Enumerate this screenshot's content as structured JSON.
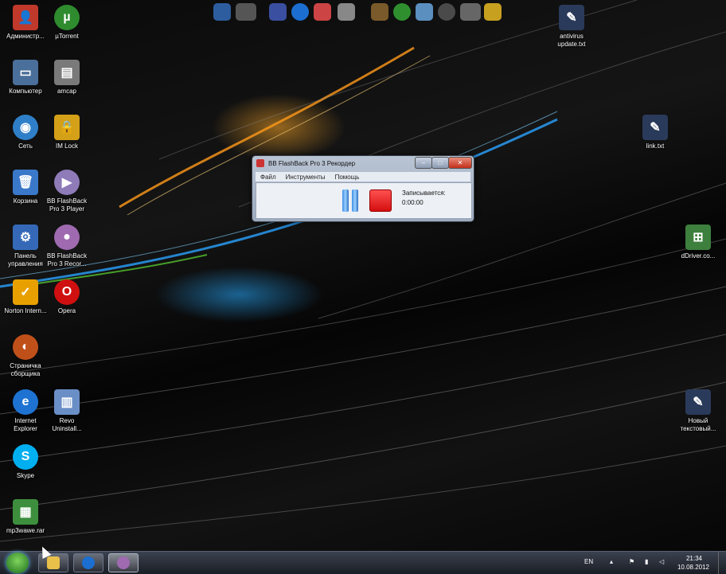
{
  "desktop_icons": [
    {
      "label": "Администр...",
      "icon": "user-icon",
      "color": "#c0392b"
    },
    {
      "label": "µTorrent",
      "icon": "utorrent-icon",
      "color": "#2e8b2e"
    },
    {
      "label": "Компьютер",
      "icon": "computer-icon",
      "color": "#4a6f9a"
    },
    {
      "label": "amcap",
      "icon": "amcap-icon",
      "color": "#7a7a7a"
    },
    {
      "label": "Сеть",
      "icon": "network-icon",
      "color": "#2f7fc8"
    },
    {
      "label": "IM Lock",
      "icon": "lock-icon",
      "color": "#d4a017"
    },
    {
      "label": "Корзина",
      "icon": "recycle-bin-icon",
      "color": "#3a78c9"
    },
    {
      "label": "BB FlashBack Pro 3 Player",
      "icon": "flashback-player-icon",
      "color": "#8e7bb8"
    },
    {
      "label": "Панель управления",
      "icon": "control-panel-icon",
      "color": "#3569b8"
    },
    {
      "label": "BB FlashBack Pro 3 Recor...",
      "icon": "flashback-recorder-icon",
      "color": "#9f6ab0"
    },
    {
      "label": "Norton Intern...",
      "icon": "norton-icon",
      "color": "#e8a000"
    },
    {
      "label": "Opera",
      "icon": "opera-icon",
      "color": "#d01010"
    },
    {
      "label": "Страничка сборщика",
      "icon": "browser-page-icon",
      "color": "#c0501a"
    },
    {
      "label": "Internet Explorer",
      "icon": "internet-explorer-icon",
      "color": "#1e73d2"
    },
    {
      "label": "Revo Uninstall...",
      "icon": "revo-uninstaller-icon",
      "color": "#6a8fc7"
    },
    {
      "label": "Skype",
      "icon": "skype-icon",
      "color": "#00aff0"
    },
    {
      "label": "mp3wawe.rar",
      "icon": "rar-archive-icon",
      "color": "#3d8f3d"
    },
    {
      "label": "antivirus update.txt",
      "icon": "text-file-icon",
      "color": "#2a3a5a"
    },
    {
      "label": "link.txt",
      "icon": "text-file-icon",
      "color": "#2a3a5a"
    },
    {
      "label": "dDriver.co...",
      "icon": "windows-file-icon",
      "color": "#3d7f3d"
    },
    {
      "label": "Новый текстовый...",
      "icon": "text-file-icon",
      "color": "#2a3a5a"
    }
  ],
  "quick_icons": [
    {
      "icon": "app-icon-1",
      "color": "#2d5d9f"
    },
    {
      "icon": "app-icon-2",
      "color": "#555555"
    },
    {
      "icon": "gamepad-icon",
      "color": "#3a4fa0"
    },
    {
      "icon": "media-player-icon",
      "color": "#1c6fd0"
    },
    {
      "icon": "paint-icon",
      "color": "#c44"
    },
    {
      "icon": "calculator-icon",
      "color": "#888888"
    },
    {
      "icon": "app-icon-3",
      "color": "#7a5a2a"
    },
    {
      "icon": "app-icon-4",
      "color": "#2f8f2f"
    },
    {
      "icon": "app-icon-5",
      "color": "#5a8fc0"
    },
    {
      "icon": "app-icon-6",
      "color": "#4a4a4a"
    },
    {
      "icon": "app-icon-7",
      "color": "#666666"
    },
    {
      "icon": "app-icon-8",
      "color": "#c8a020"
    }
  ],
  "recorder": {
    "title": "BB FlashBack Pro 3 Рекордер",
    "menu": [
      "Файл",
      "Инструменты",
      "Помощь"
    ],
    "status": "Записывается:",
    "time": "0:00:00",
    "min_glyph": "–",
    "max_glyph": "□",
    "close_glyph": "✕"
  },
  "taskbar": {
    "buttons": [
      {
        "icon": "explorer-folder-icon",
        "color": "#e8c04a"
      },
      {
        "icon": "media-player-icon",
        "color": "#1c6fd0"
      },
      {
        "icon": "flashback-recorder-icon",
        "color": "#9f6ab0"
      }
    ],
    "lang": "EN",
    "time": "21:34",
    "date": "10.08.2012"
  }
}
